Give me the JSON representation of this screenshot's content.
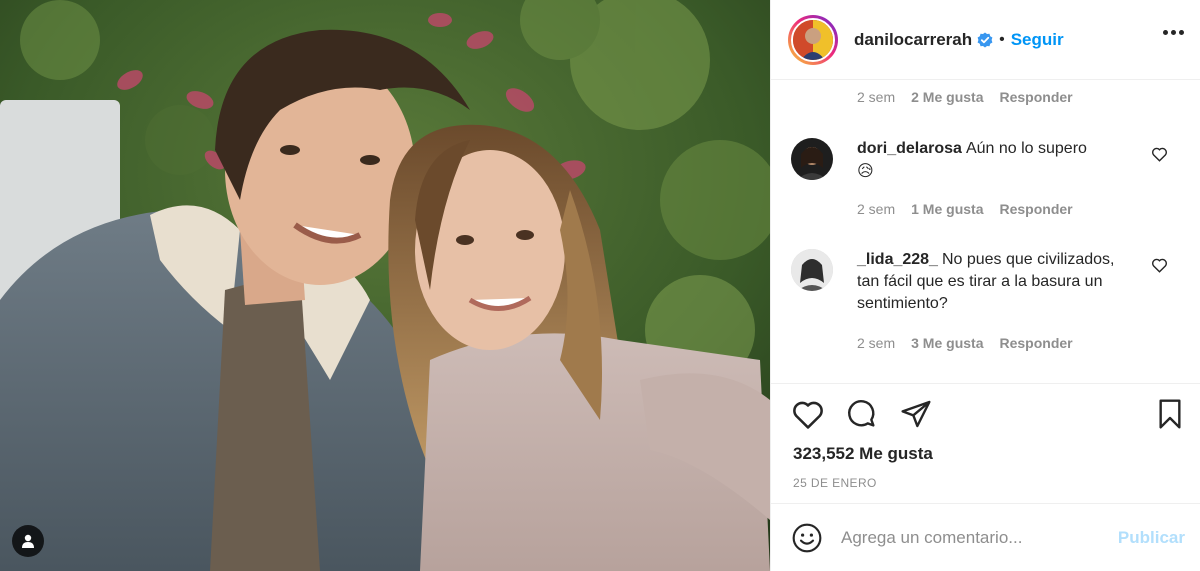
{
  "post": {
    "author": "danilocarrerah",
    "separator": "•",
    "follow_label": "Seguir",
    "likes_count": "323,552 Me gusta",
    "date": "25 DE ENERO"
  },
  "comments": [
    {
      "text": "",
      "time": "2 sem",
      "likes": "2 Me gusta",
      "reply": "Responder"
    },
    {
      "user": "dori_delarosa",
      "text": "Aún no lo supero",
      "emoji": "😥",
      "time": "2 sem",
      "likes": "1 Me gusta",
      "reply": "Responder"
    },
    {
      "user": "_lida_228_",
      "text": "No pues que civilizados, tan fácil que es tirar a la basura un sentimiento?",
      "time": "2 sem",
      "likes": "3 Me gusta",
      "reply": "Responder"
    }
  ],
  "composer": {
    "placeholder": "Agrega un comentario...",
    "publish_label": "Publicar"
  },
  "icons": {
    "verified": "verified-badge-icon",
    "more": "more-options-icon",
    "heart": "heart-icon",
    "comment": "comment-icon",
    "share": "paper-plane-icon",
    "bookmark": "bookmark-icon",
    "emoji": "smiley-icon",
    "tag": "person-tag-icon"
  },
  "colors": {
    "link_blue": "#0095f6",
    "publish_disabled": "#b2dffc",
    "muted": "#8e8e8e",
    "verified": "#3897f0"
  }
}
